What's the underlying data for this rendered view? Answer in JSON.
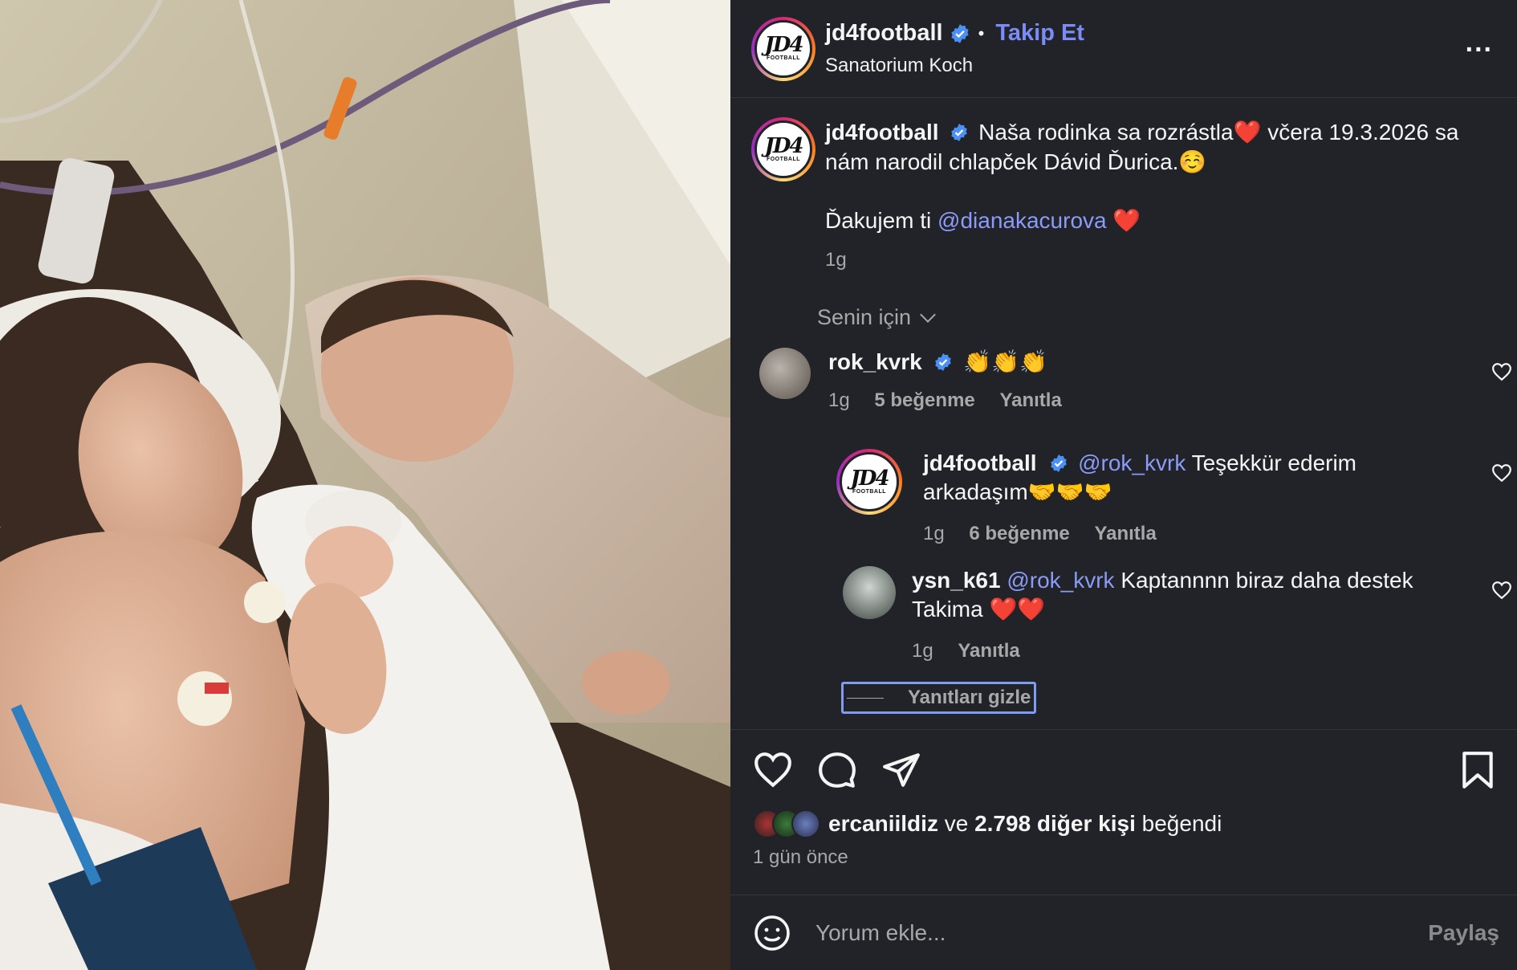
{
  "post": {
    "username": "jd4football",
    "follow_label": "Takip Et",
    "location": "Sanatorium Koch",
    "more_label": "...",
    "logo_text": "JD4",
    "logo_sub": "FOOTBALL",
    "verified_icon": "verified-badge-icon"
  },
  "caption": {
    "username": "jd4football",
    "text_line1": "Naša rodinka sa rozrástla❤️ včera 19.3.2026 sa nám narodil chlapček Dávid Ďurica.☺️",
    "thanks_prefix": "Ďakujem ti ",
    "thanks_mention": "@dianakacurova",
    "thanks_suffix": " ❤️",
    "time": "1g"
  },
  "sort_label": "Senin için",
  "comments": [
    {
      "username": "rok_kvrk",
      "verified": true,
      "text": "👏👏👏",
      "time": "1g",
      "likes": "5 beğenme",
      "reply": "Yanıtla"
    }
  ],
  "replies": [
    {
      "username": "jd4football",
      "verified": true,
      "mention": "@rok_kvrk",
      "text": " Teşekkür ederim arkadaşım🤝🤝🤝",
      "time": "1g",
      "likes": "6 beğenme",
      "reply": "Yanıtla"
    },
    {
      "username": "ysn_k61",
      "verified": false,
      "mention": "@rok_kvrk",
      "text": " Kaptannnn biraz daha destek Takima ❤️❤️",
      "time": "1g",
      "reply": "Yanıtla"
    }
  ],
  "hide_replies": "Yanıtları gizle",
  "likes_summary": {
    "first_user": "ercaniildiz",
    "connector": " ve ",
    "others": "2.798 diğer kişi",
    "suffix": " beğendi"
  },
  "post_age": "1 gün önce",
  "composer": {
    "placeholder": "Yorum ekle...",
    "share_label": "Paylaş"
  },
  "colors": {
    "panel_bg": "#212328",
    "link": "#7b8cf6",
    "muted": "#a8a8a8",
    "verified": "#4a90f5"
  }
}
